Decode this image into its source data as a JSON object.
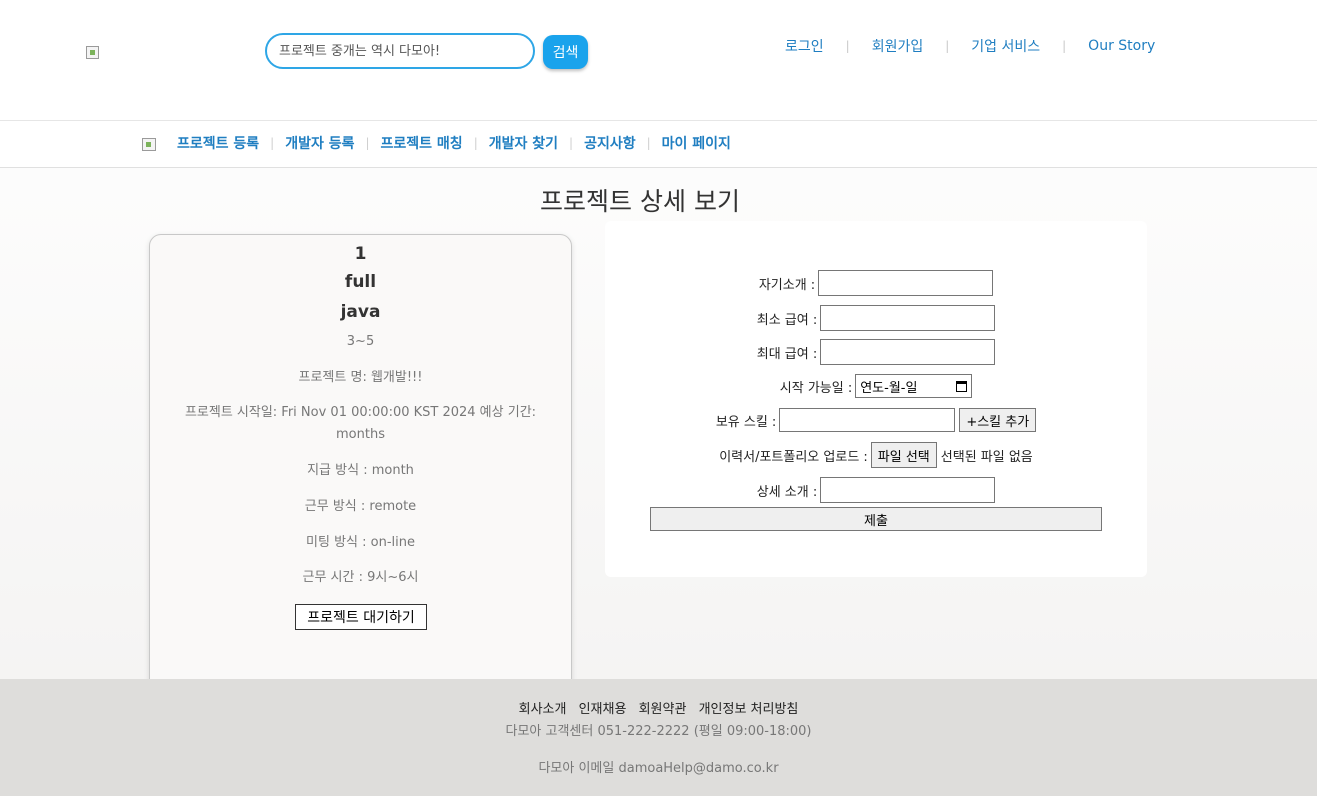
{
  "header": {
    "search_placeholder": "프로젝트 중개는 역시 다모아!",
    "search_button": "검색",
    "links": [
      "로그인",
      "회원가입",
      "기업 서비스",
      "Our Story"
    ],
    "link_color": "#1f7ec1"
  },
  "nav": {
    "items": [
      "프로젝트 등록",
      "개발자 등록",
      "프로젝트 매칭",
      "개발자 찾기",
      "공지사항",
      "마이 페이지"
    ]
  },
  "page_title": "프로젝트 상세 보기",
  "project": {
    "number": "1",
    "type": "full",
    "language": "java",
    "career": "3~5",
    "name_line": "프로젝트 명: 웹개발!!!",
    "period_line": "프로젝트 시작일: Fri Nov 01 00:00:00 KST 2024 예상 기간: months",
    "payment_line": "지급 방식 : month",
    "work_line": "근무 방식 : remote",
    "meeting_line": "미팅 방식 : on-line",
    "hours_line": "근무 시간 : 9시~6시",
    "wait_button": "프로젝트 대기하기"
  },
  "form": {
    "intro_label": "자기소개 :",
    "min_salary_label": "최소 급여 :",
    "max_salary_label": "최대 급여 :",
    "start_label": "시작 가능일 :",
    "date_placeholder": "연도-월-일",
    "skill_label": "보유 스킬 :",
    "add_skill_button": "+스킬 추가",
    "upload_label": "이력서/포트폴리오 업로드 :",
    "file_button": "파일 선택",
    "file_status": "선택된 파일 없음",
    "detail_label": "상세 소개 :",
    "submit_button": "제출"
  },
  "footer": {
    "links": [
      "회사소개",
      "인재채용",
      "회원약관",
      "개인정보 처리방침"
    ],
    "support": "다모아 고객센터 051-222-2222 (평일 09:00-18:00)",
    "email": "다모아 이메일 damoaHelp@damo.co.kr"
  }
}
